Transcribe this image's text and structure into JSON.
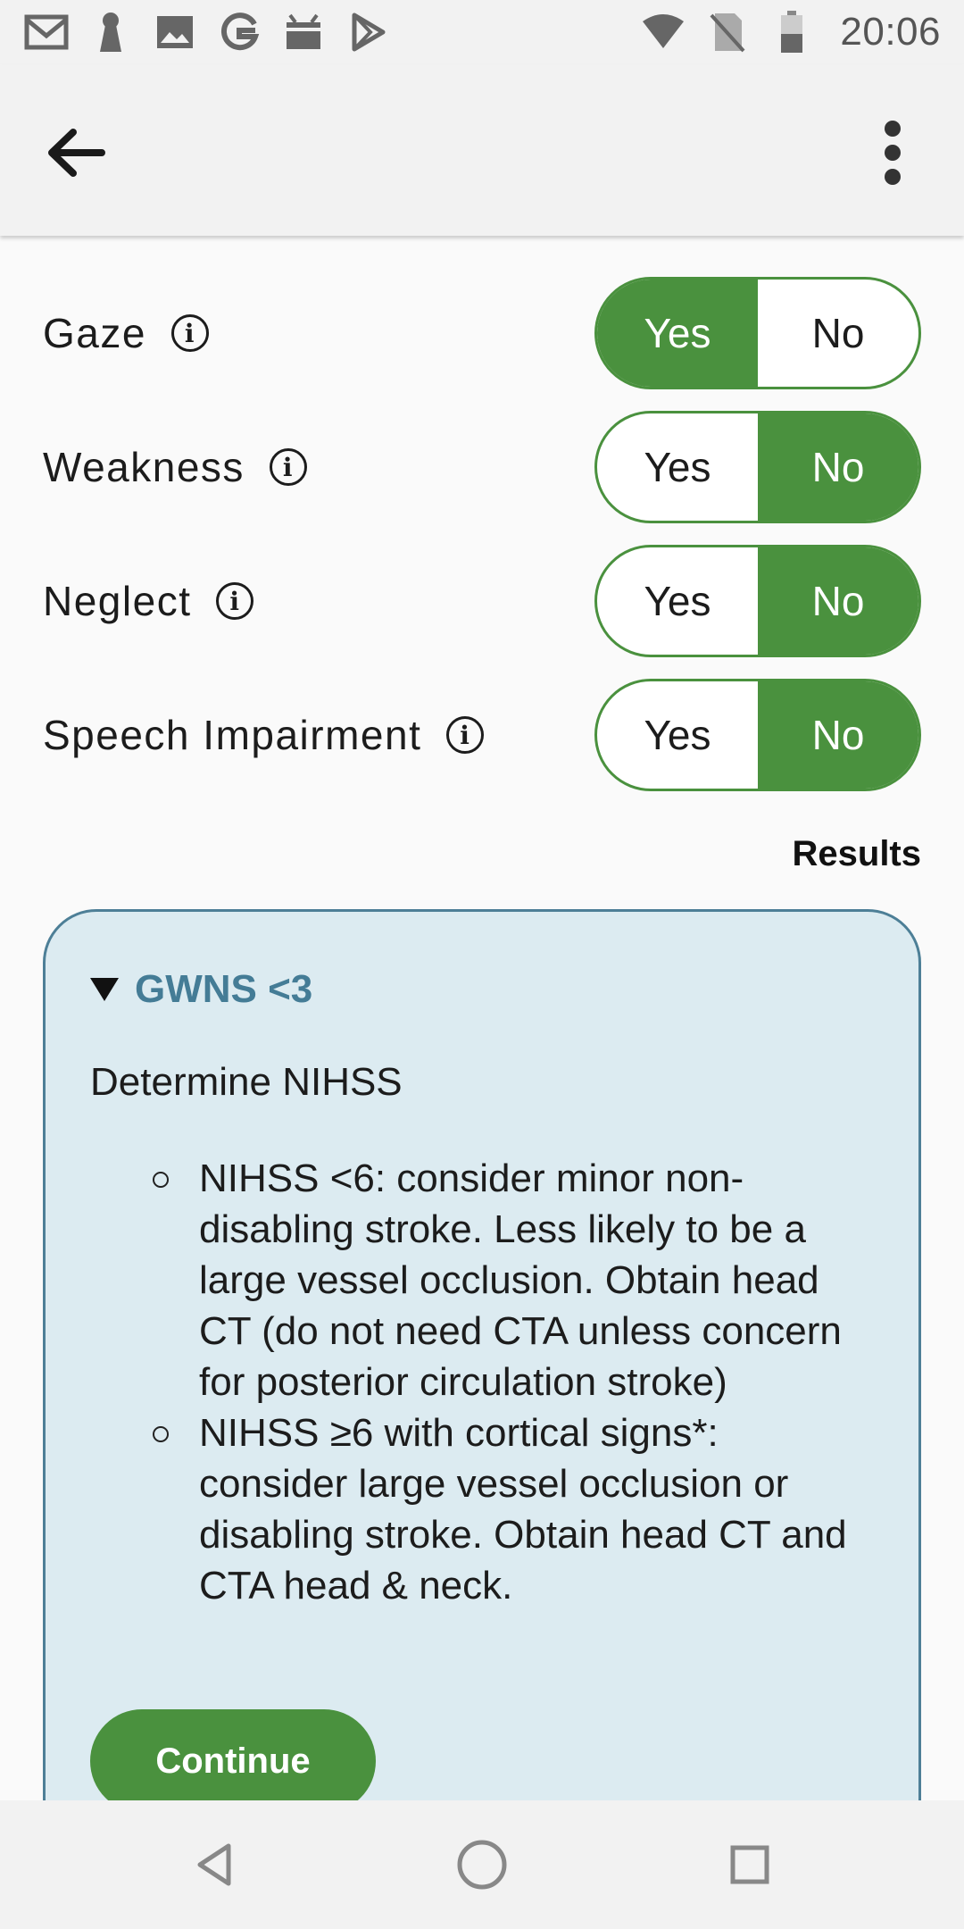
{
  "status_bar": {
    "time": "20:06",
    "left_icons": [
      "gmail-icon",
      "keyhole-icon",
      "image-icon",
      "google-icon",
      "robot-icon",
      "play-store-icon"
    ],
    "right_icons": [
      "wifi-icon",
      "no-sim-icon",
      "battery-icon"
    ]
  },
  "app_bar": {
    "back_icon": "arrow-back-icon",
    "menu_icon": "more-vert-icon"
  },
  "questions": [
    {
      "label": "Gaze",
      "yes": "Yes",
      "no": "No",
      "selected": "Yes"
    },
    {
      "label": "Weakness",
      "yes": "Yes",
      "no": "No",
      "selected": "No"
    },
    {
      "label": "Neglect",
      "yes": "Yes",
      "no": "No",
      "selected": "No"
    },
    {
      "label": "Speech Impairment",
      "yes": "Yes",
      "no": "No",
      "selected": "No"
    }
  ],
  "info_glyph": "i",
  "results": {
    "heading": "Results",
    "card_title": "GWNS <3",
    "card_subtitle": "Determine NIHSS",
    "items": [
      "NIHSS <6: consider minor non-disabling stroke. Less likely to be a large vessel occlusion. Obtain head CT (do not need CTA unless concern for posterior circulation stroke)",
      "NIHSS ≥6 with cortical signs*: consider large vessel occlusion or disabling stroke. Obtain head CT and CTA head & neck."
    ],
    "continue_label": "Continue"
  },
  "colors": {
    "accent_green": "#4a913e",
    "card_bg": "#dcebf1",
    "card_border": "#4d7f97",
    "title_blue": "#447c96"
  }
}
